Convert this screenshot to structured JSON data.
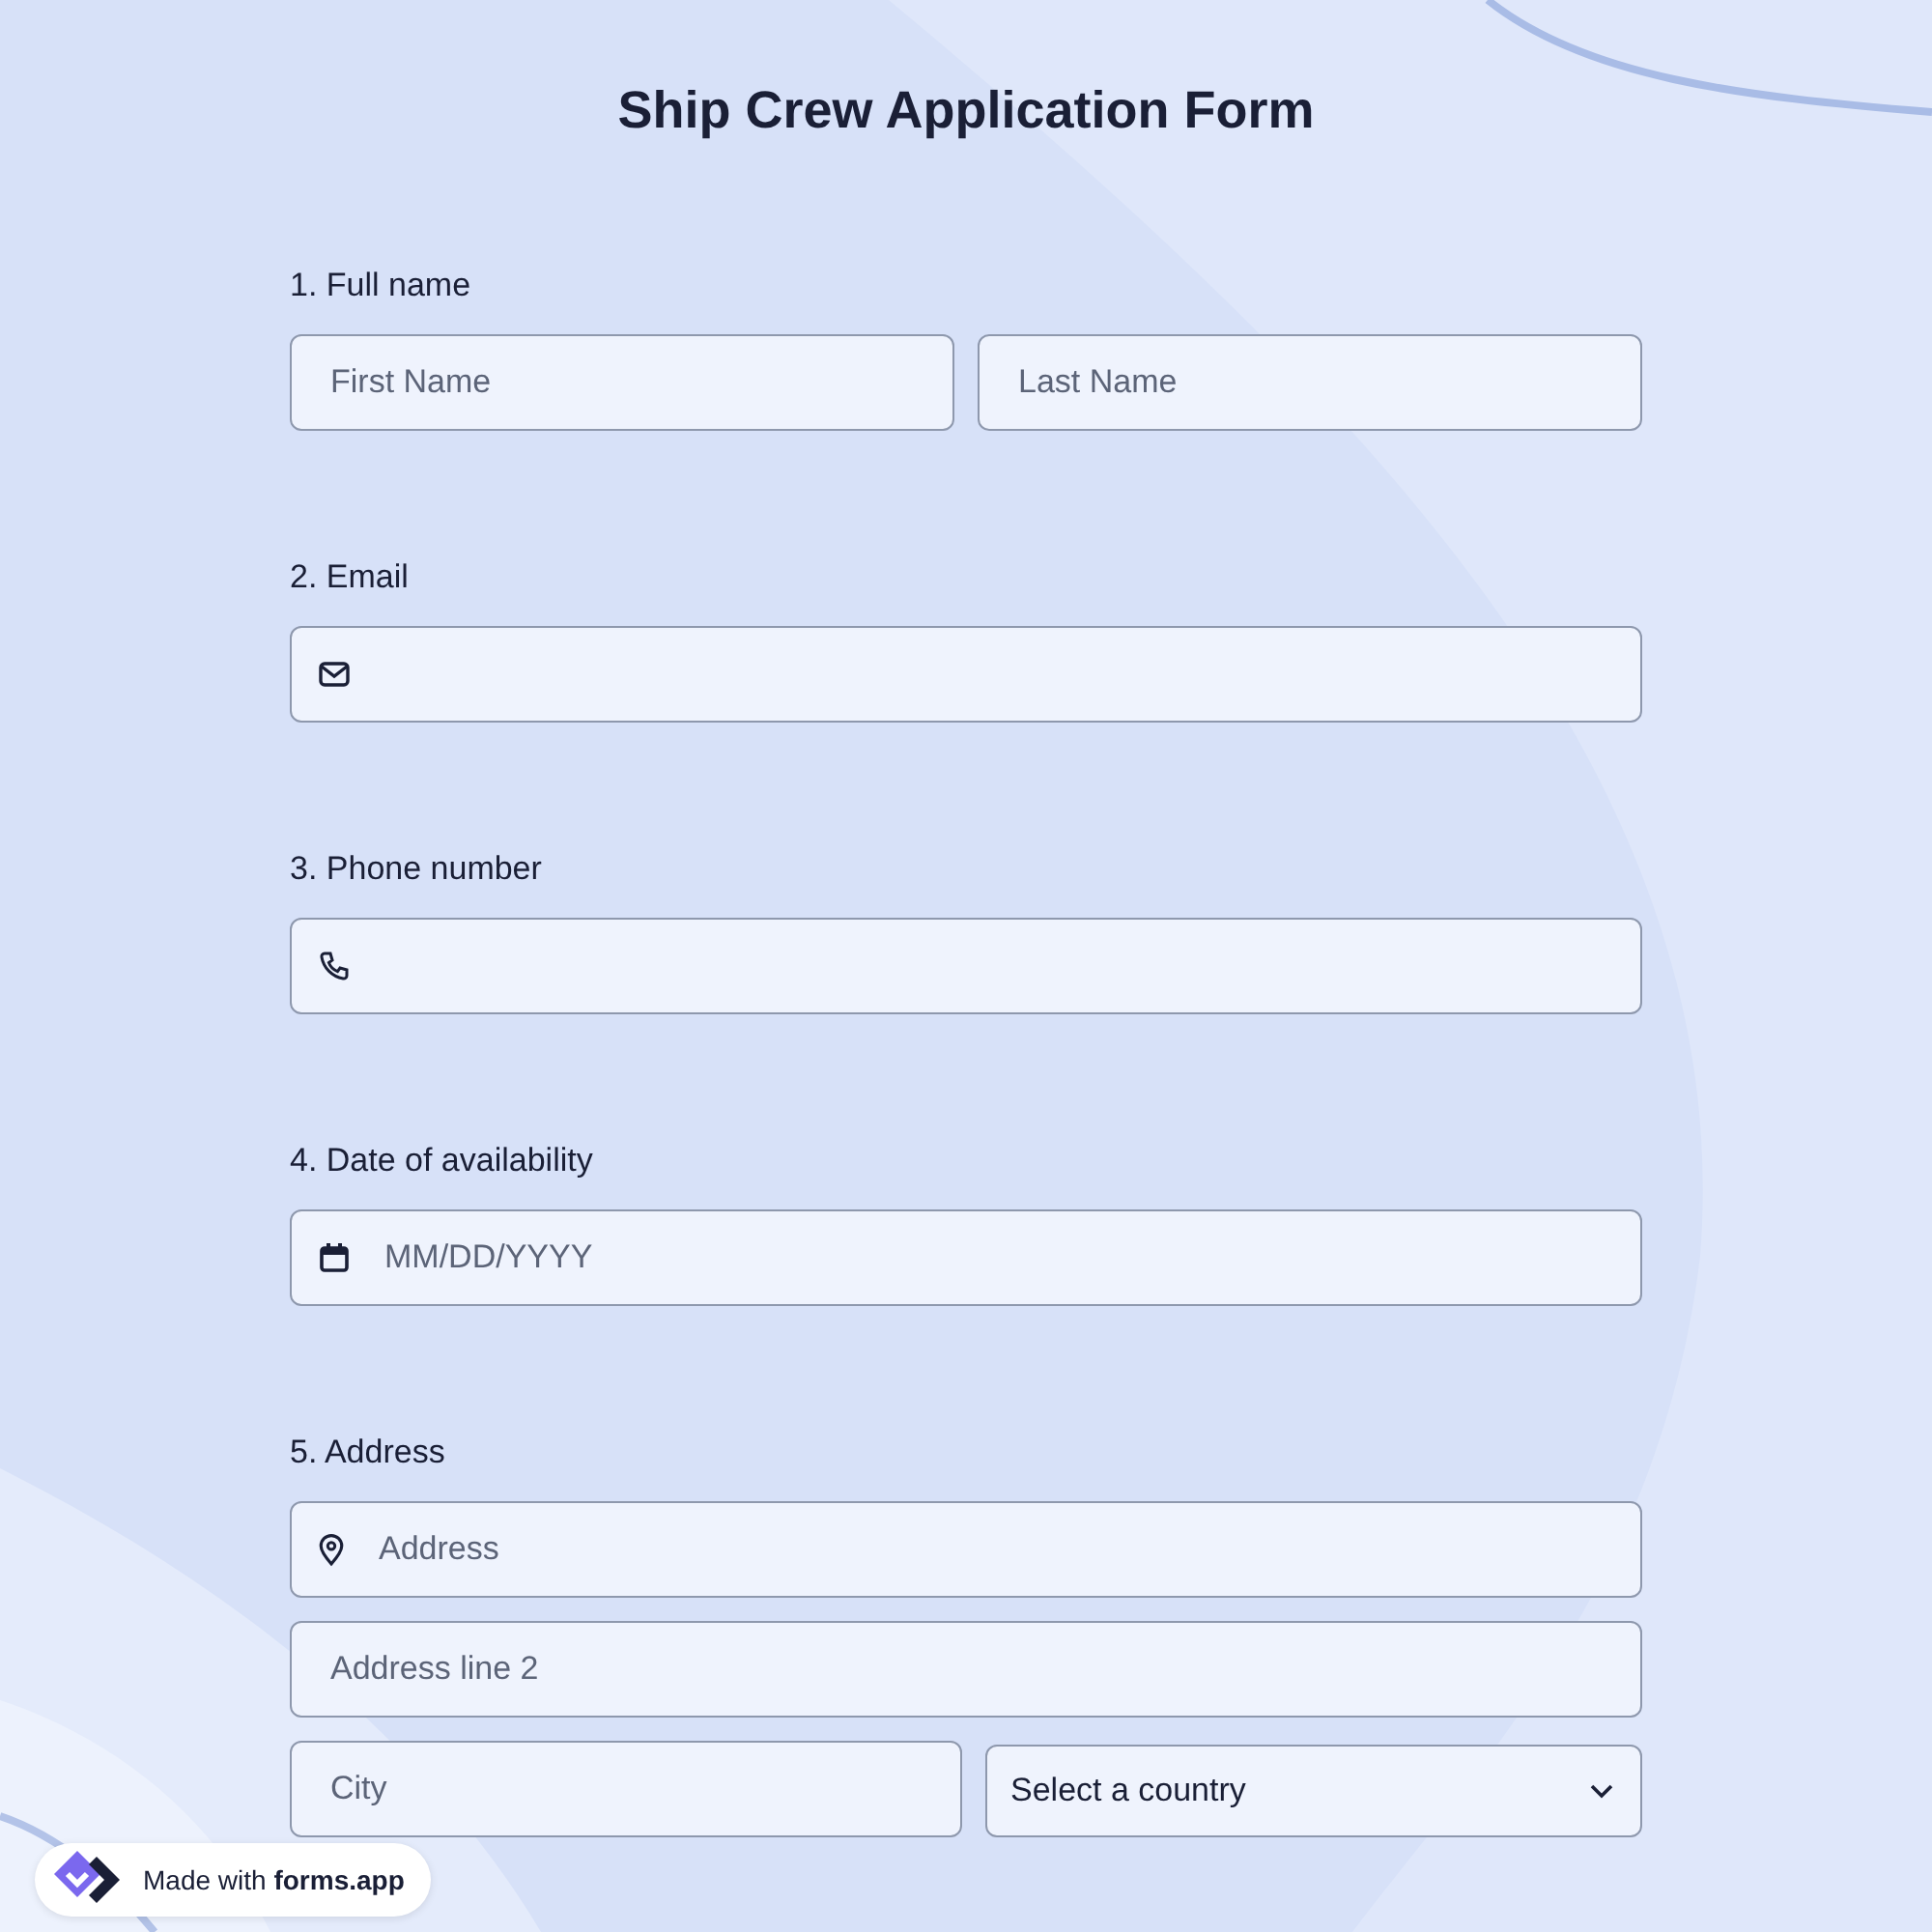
{
  "title": "Ship Crew Application Form",
  "questions": [
    {
      "label": "1.  Full name",
      "rows": [
        [
          {
            "kind": "text",
            "placeholder": "First Name"
          },
          {
            "kind": "text",
            "placeholder": "Last Name"
          }
        ]
      ]
    },
    {
      "label": "2. Email",
      "rows": [
        [
          {
            "kind": "email"
          }
        ]
      ]
    },
    {
      "label": "3. Phone number",
      "rows": [
        [
          {
            "kind": "phone"
          }
        ]
      ]
    },
    {
      "label": "4. Date of availability",
      "rows": [
        [
          {
            "kind": "date",
            "placeholder": "MM/DD/YYYY"
          }
        ]
      ]
    },
    {
      "label": "5. Address",
      "rows": [
        [
          {
            "kind": "address",
            "placeholder": "Address"
          }
        ],
        [
          {
            "kind": "text",
            "placeholder": "Address line 2"
          }
        ],
        [
          {
            "kind": "text",
            "placeholder": "City"
          },
          {
            "kind": "select",
            "value": "Select a country"
          }
        ]
      ]
    }
  ],
  "badge": {
    "text": "Made with ",
    "brand": "forms.app"
  }
}
